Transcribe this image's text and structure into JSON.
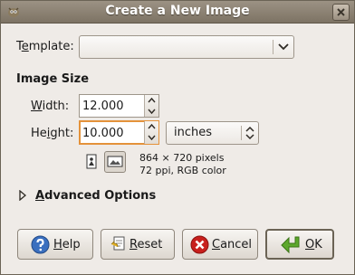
{
  "window": {
    "title": "Create a New Image"
  },
  "template": {
    "label_pre": "T",
    "label_mnemonic": "e",
    "label_post": "mplate:",
    "value": ""
  },
  "image_size": {
    "heading": "Image Size",
    "width": {
      "label_pre": "",
      "label_mnemonic": "W",
      "label_post": "idth:",
      "value": "12.000"
    },
    "height": {
      "label_pre": "He",
      "label_mnemonic": "i",
      "label_post": "ght:",
      "value": "10.000"
    },
    "units": "inches",
    "pixels_info": "864 × 720 pixels",
    "resolution_info": "72 ppi, RGB color"
  },
  "advanced": {
    "label_pre": "",
    "label_mnemonic": "A",
    "label_post": "dvanced Options"
  },
  "buttons": {
    "help": {
      "mnemonic": "H",
      "rest": "elp"
    },
    "reset": {
      "mnemonic": "R",
      "rest": "eset"
    },
    "cancel": {
      "mnemonic": "C",
      "rest": "ancel"
    },
    "ok": {
      "mnemonic": "O",
      "rest": "K"
    }
  },
  "icons": {
    "app": "gimp-icon",
    "close": "close-icon",
    "help": "help-icon",
    "reset": "reset-icon",
    "cancel": "cancel-icon",
    "ok": "ok-arrow-icon",
    "portrait": "portrait-orientation-icon",
    "landscape": "landscape-orientation-icon"
  },
  "colors": {
    "help_icon": "#3a6fbf",
    "cancel_icon": "#c8201d",
    "ok_icon": "#5da82c",
    "focus": "#e4923a"
  }
}
